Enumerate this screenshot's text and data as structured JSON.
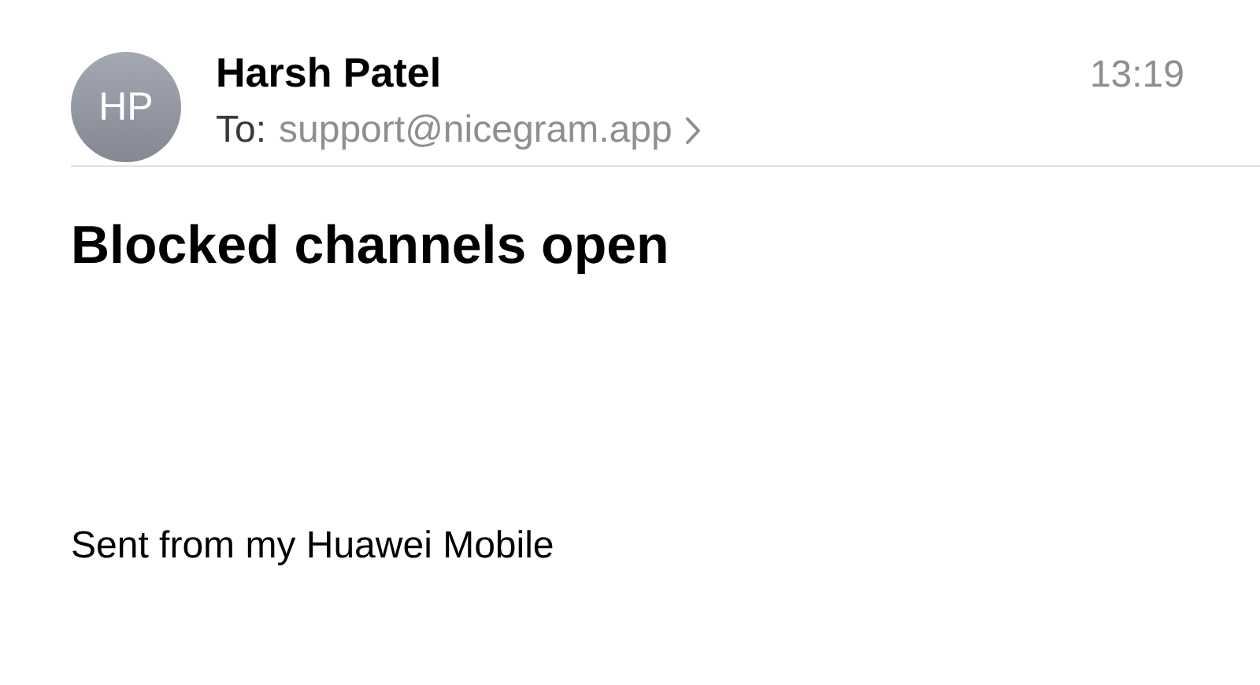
{
  "header": {
    "avatar_initials": "HP",
    "sender": "Harsh Patel",
    "to_label": "To:",
    "recipient": "support@nicegram.app",
    "time": "13:19"
  },
  "subject": "Blocked channels open",
  "body": "Sent from my Huawei Mobile"
}
